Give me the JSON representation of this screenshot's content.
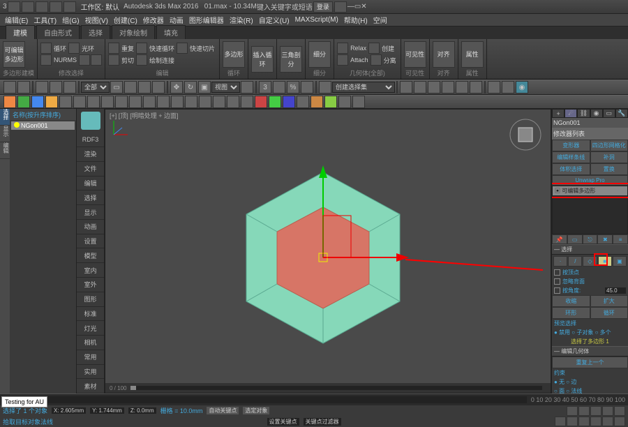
{
  "titlebar": {
    "app": "Autodesk 3ds Max 2016",
    "file": "01.max",
    "mem": "10.34M",
    "search_ph": "键入关键字或短语",
    "login": "登录"
  },
  "qat": {
    "workspace_label": "工作区: 默认"
  },
  "menus": [
    "编辑(E)",
    "工具(T)",
    "组(G)",
    "视图(V)",
    "创建(C)",
    "修改器",
    "动画",
    "图形编辑器",
    "渲染(R)",
    "自定义(U)",
    "MAXScript(M)",
    "帮助(H)",
    "空间"
  ],
  "ribbon": {
    "tabs": [
      "建模",
      "自由形式",
      "选择",
      "对象绘制",
      "填充"
    ],
    "groups": [
      {
        "label": "多边形建模",
        "big": "可编辑多边形"
      },
      {
        "label": "修改选择",
        "items": [
          "循环",
          "光环",
          "NURMS"
        ]
      },
      {
        "label": "编辑",
        "items": [
          "重复",
          "快速循环",
          "快速切片",
          "剪切",
          "绘制连接"
        ]
      },
      {
        "label": "循环",
        "big": "多边形"
      },
      {
        "label": "",
        "big": "插入循环"
      },
      {
        "label": "",
        "big": "三角剖分"
      },
      {
        "label": "细分",
        "big": "细分"
      },
      {
        "label": "几何体(全部)",
        "items": [
          "Relax",
          "Attach",
          "分离",
          "创建"
        ]
      },
      {
        "label": "可见性",
        "big": "可见性"
      },
      {
        "label": "对齐",
        "big": "对齐"
      },
      {
        "label": "属性",
        "big": "属性"
      }
    ]
  },
  "toolbar": {
    "combo": "创建选择集"
  },
  "scene": {
    "header": "名称(按升序排序)",
    "node": "NGon001"
  },
  "viewcol": [
    "RDF3",
    "渲染",
    "文件",
    "编辑",
    "选择",
    "显示",
    "动画",
    "设置",
    "模型",
    "室内",
    "室外",
    "图形",
    "标准",
    "灯光",
    "相机",
    "常用",
    "实用",
    "素材"
  ],
  "viewport": {
    "label": "[+] [顶] [明暗处理 + 边面]"
  },
  "timeline": {
    "range": "0 / 100"
  },
  "right": {
    "obj": "NGon001",
    "modlist_label": "修改器列表",
    "btns": [
      "变形器",
      "四边形网格化",
      "编辑样条线",
      "补洞",
      "体积选择",
      "置换",
      "Unwrap Pro"
    ],
    "modifier": "可编辑多边形",
    "rollouts": {
      "selection": "选择",
      "by_vertex": "按顶点",
      "ignore_back": "忽略背面",
      "by_angle": "按角度:",
      "angle": "45.0",
      "shrink": "收缩",
      "grow": "扩大",
      "ring": "环形",
      "loop": "循环",
      "preview_sel": "预览选择",
      "off": "禁用",
      "subobj": "子对象",
      "multi": "多个",
      "selected": "选择了多边形 1",
      "edit_geom": "编辑几何体",
      "repeat_last": "重复上一个",
      "constraint": "约束",
      "none": "无",
      "edge": "边",
      "face": "面",
      "normal": "法线"
    }
  },
  "status": {
    "sel": "选择了 1 个对象",
    "hint": "拾取目标对象法线",
    "x": "X: 2.605mm",
    "y": "Y: 1.744mm",
    "z": "Z: 0.0mm",
    "grid": "栅格 = 10.0mm",
    "autokey": "自动关键点",
    "setkey": "设置关键点",
    "selkey": "选定对象",
    "keyfilter": "关键点过滤器"
  },
  "testing": "Testing for AU",
  "selectmode": {
    "select": "选择",
    "display": "显示",
    "edit": "编辑"
  }
}
